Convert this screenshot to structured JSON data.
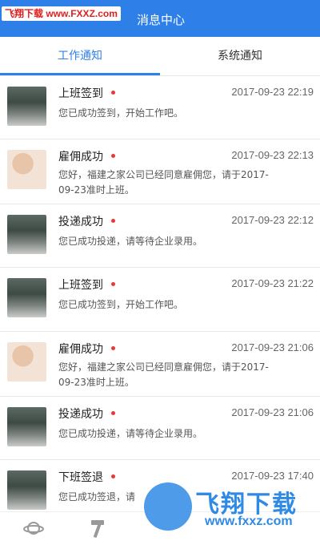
{
  "header": {
    "watermark": "飞翔下载 www.FXXZ.com",
    "title": "消息中心"
  },
  "tabs": [
    {
      "label": "工作通知",
      "active": true
    },
    {
      "label": "系统通知",
      "active": false
    }
  ],
  "messages": [
    {
      "title": "上班签到",
      "time": "2017-09-23 22:19",
      "body": "您已成功签到，开始工作吧。",
      "avatar": "screen"
    },
    {
      "title": "雇佣成功",
      "time": "2017-09-23 22:13",
      "body": "您好，福建之家公司已经同意雇佣您，请于2017-09-23准时上班。",
      "avatar": "person"
    },
    {
      "title": "投递成功",
      "time": "2017-09-23 22:12",
      "body": "您已成功投递，请等待企业录用。",
      "avatar": "screen"
    },
    {
      "title": "上班签到",
      "time": "2017-09-23 21:22",
      "body": "您已成功签到，开始工作吧。",
      "avatar": "screen"
    },
    {
      "title": "雇佣成功",
      "time": "2017-09-23 21:06",
      "body": "您好，福建之家公司已经同意雇佣您，请于2017-09-23准时上班。",
      "avatar": "person"
    },
    {
      "title": "投递成功",
      "time": "2017-09-23 21:06",
      "body": "您已成功投递，请等待企业录用。",
      "avatar": "screen"
    },
    {
      "title": "下班签退",
      "time": "2017-09-23 17:40",
      "body": "您已成功签退，请",
      "avatar": "screen"
    }
  ],
  "bottom_nav": [
    {
      "icon": "planet-icon"
    },
    {
      "icon": "hammer-icon"
    }
  ],
  "watermark_bottom": {
    "text": "飞翔下载",
    "url": "www.fxxz.com"
  },
  "colors": {
    "primary": "#2f7fe8",
    "dot": "#e53935"
  }
}
